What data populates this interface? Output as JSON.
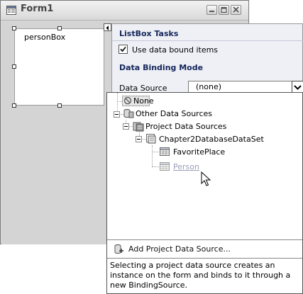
{
  "window": {
    "title": "Form1"
  },
  "listbox": {
    "name": "personBox"
  },
  "tasks": {
    "header": "ListBox Tasks",
    "use_data_bound_items": {
      "label": "Use data bound items",
      "checked": true
    },
    "data_binding_mode_header": "Data Binding Mode",
    "data_source": {
      "label": "Data Source",
      "value": "(none)"
    }
  },
  "dropdown": {
    "tree": [
      {
        "label": "None",
        "icon": "none-icon"
      },
      {
        "label": "Other Data Sources",
        "icon": "data-sources-icon"
      },
      {
        "label": "Project Data Sources",
        "icon": "project-data-sources-icon"
      },
      {
        "label": "Chapter2DatabaseDataSet",
        "icon": "dataset-icon"
      },
      {
        "label": "FavoritePlace",
        "icon": "table-icon"
      },
      {
        "label": "Person",
        "icon": "table-icon"
      }
    ],
    "add_project_data_source": "Add Project Data Source...",
    "description": "Selecting a project data source creates an instance on the form and binds to it through a new BindingSource."
  },
  "colors": {
    "panel_background": "#eef0f6",
    "header_text": "#15265a",
    "hover_link": "#9aa0b8",
    "form_background": "#d4d4d4"
  }
}
